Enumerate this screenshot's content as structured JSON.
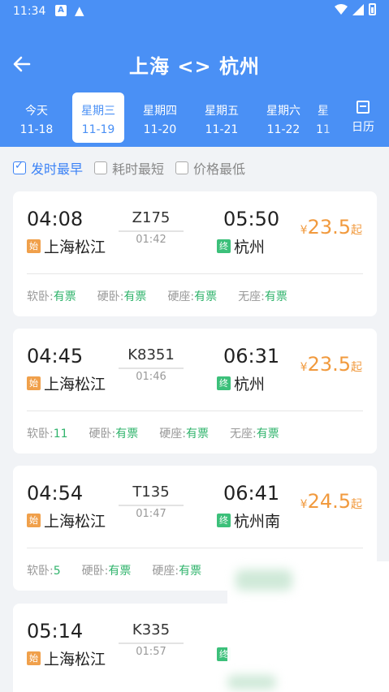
{
  "status_bar": {
    "time": "11:34"
  },
  "header": {
    "title": "上海 <> 杭州",
    "back_icon": "arrow-left-icon",
    "tabs": [
      {
        "weekday": "今天",
        "date": "11-18"
      },
      {
        "weekday": "星期三",
        "date": "11-19"
      },
      {
        "weekday": "星期四",
        "date": "11-20"
      },
      {
        "weekday": "星期五",
        "date": "11-21"
      },
      {
        "weekday": "星期六",
        "date": "11-22"
      },
      {
        "weekday": "星",
        "date": "11"
      }
    ],
    "calendar_label": "日历"
  },
  "sort_options": [
    {
      "label": "发时最早",
      "checked": true
    },
    {
      "label": "耗时最短",
      "checked": false
    },
    {
      "label": "价格最低",
      "checked": false
    }
  ],
  "tags": {
    "start": "始",
    "end": "终"
  },
  "currency": "¥",
  "price_suffix": "起",
  "trains": [
    {
      "depart": "04:08",
      "train_no": "Z175",
      "duration": "01:42",
      "arrive": "05:50",
      "from": "上海松江",
      "to": "杭州",
      "price": "23.5",
      "seats": [
        {
          "type": "软卧:",
          "avail": "有票"
        },
        {
          "type": "硬卧:",
          "avail": "有票"
        },
        {
          "type": "硬座:",
          "avail": "有票"
        },
        {
          "type": "无座:",
          "avail": "有票"
        }
      ]
    },
    {
      "depart": "04:45",
      "train_no": "K8351",
      "duration": "01:46",
      "arrive": "06:31",
      "from": "上海松江",
      "to": "杭州",
      "price": "23.5",
      "seats": [
        {
          "type": "软卧:",
          "avail": "11"
        },
        {
          "type": "硬卧:",
          "avail": "有票"
        },
        {
          "type": "硬座:",
          "avail": "有票"
        },
        {
          "type": "无座:",
          "avail": "有票"
        }
      ]
    },
    {
      "depart": "04:54",
      "train_no": "T135",
      "duration": "01:47",
      "arrive": "06:41",
      "from": "上海松江",
      "to": "杭州南",
      "price": "24.5",
      "seats": [
        {
          "type": "软卧:",
          "avail": "5"
        },
        {
          "type": "硬卧:",
          "avail": "有票"
        },
        {
          "type": "硬座:",
          "avail": "有票"
        }
      ]
    },
    {
      "depart": "05:14",
      "train_no": "K335",
      "duration": "01:57",
      "arrive": "",
      "from": "上海松江",
      "to": "",
      "price": "",
      "seats": []
    }
  ]
}
